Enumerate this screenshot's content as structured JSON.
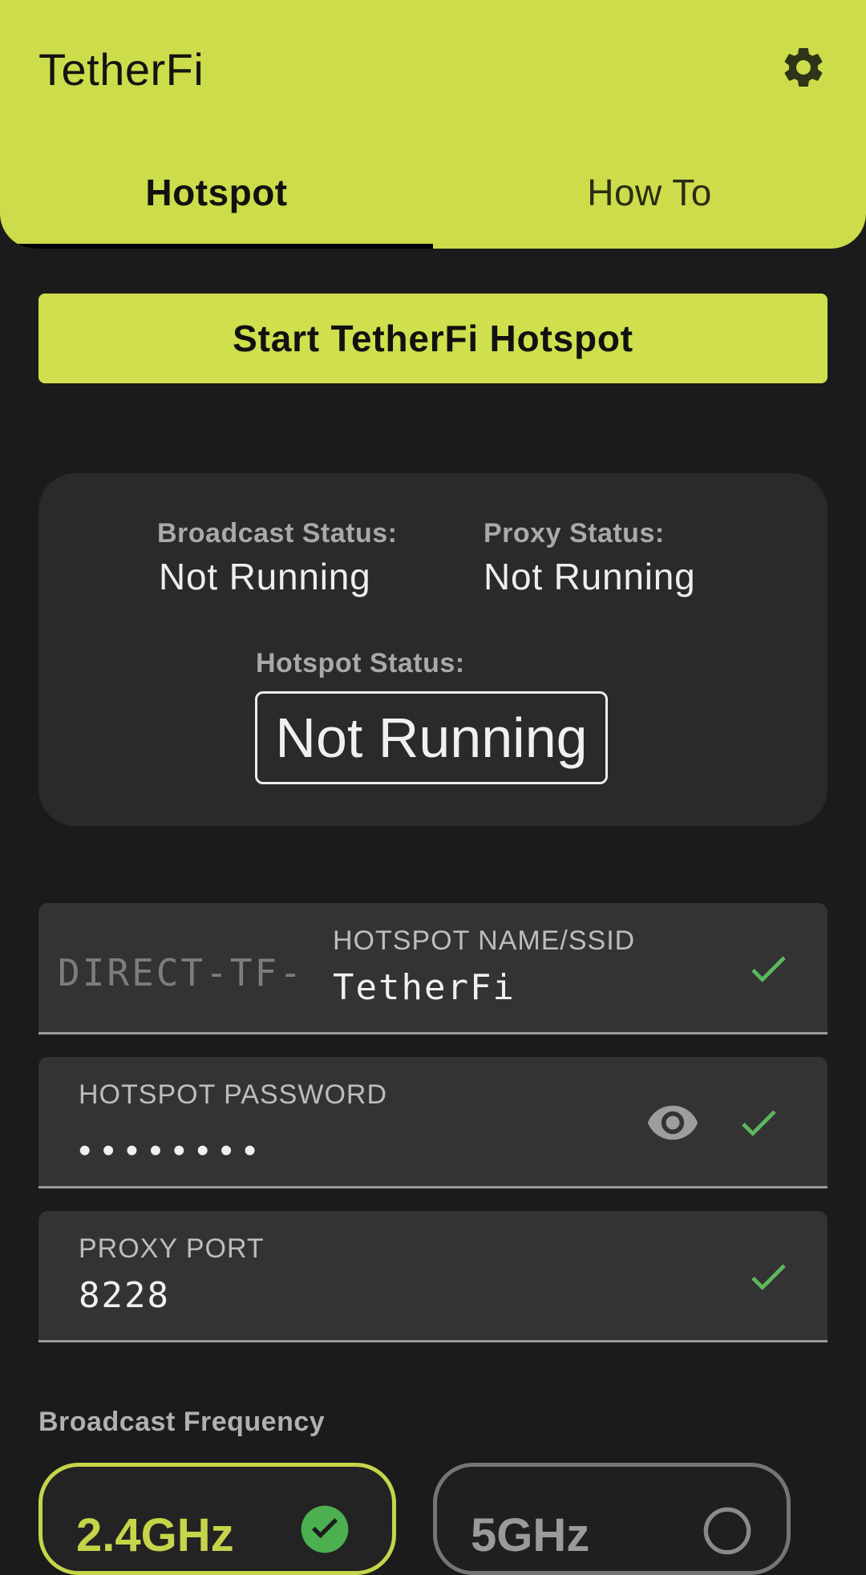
{
  "app": {
    "title": "TetherFi",
    "settings_icon": "gear-icon",
    "accent": "#cddc4a"
  },
  "tabs": [
    {
      "label": "Hotspot",
      "active": true
    },
    {
      "label": "How To",
      "active": false
    }
  ],
  "start_button": {
    "label": "Start TetherFi Hotspot"
  },
  "status": {
    "broadcast": {
      "label": "Broadcast Status:",
      "value": "Not Running"
    },
    "proxy": {
      "label": "Proxy Status:",
      "value": "Not Running"
    },
    "hotspot": {
      "label": "Hotspot Status:",
      "value": "Not Running"
    }
  },
  "fields": {
    "ssid": {
      "prefix": "DIRECT-TF-",
      "label": "HOTSPOT NAME/SSID",
      "value": "TetherFi",
      "valid_icon": "check-icon"
    },
    "password": {
      "label": "HOTSPOT PASSWORD",
      "value": "••••••••",
      "visibility_icon": "eye-icon",
      "valid_icon": "check-icon"
    },
    "port": {
      "label": "PROXY PORT",
      "value": "8228",
      "valid_icon": "check-icon"
    }
  },
  "frequency": {
    "label": "Broadcast Frequency",
    "options": [
      {
        "label": "2.4GHz",
        "selected": true
      },
      {
        "label": "5GHz",
        "selected": false
      }
    ]
  }
}
